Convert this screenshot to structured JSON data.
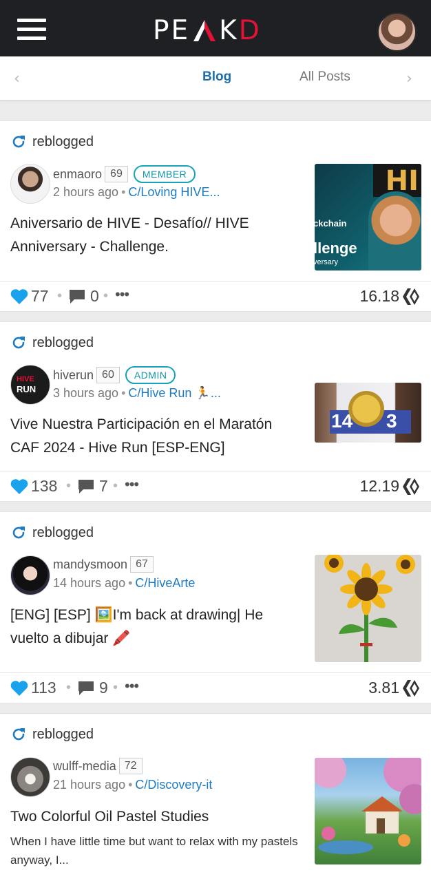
{
  "header": {
    "logo_left": "PE",
    "logo_right": "K",
    "logo_accent": "D"
  },
  "tabs": {
    "active": "Blog",
    "inactive": "All Posts"
  },
  "posts": [
    {
      "reblog_label": "reblogged",
      "author": "enmaoro",
      "reputation": "69",
      "role": "MEMBER",
      "time": "2 hours ago",
      "community": "C/Loving HIVE...",
      "title": "Aniversario de HIVE - Desafío// HIVE Anniversary - Challenge.",
      "upvotes": "77",
      "comments": "0",
      "payout": "16.18",
      "thumb_text_1": "ckchain",
      "thumb_text_2": "llenge",
      "thumb_text_3": "versary",
      "thumb_text_4": "HI"
    },
    {
      "reblog_label": "reblogged",
      "author": "hiverun",
      "reputation": "60",
      "role": "ADMIN",
      "time": "3 hours ago",
      "community": "C/Hive Run 🏃...",
      "title": "Vive Nuestra Participación en el Maratón CAF 2024 - Hive Run [ESP-ENG]",
      "upvotes": "138",
      "comments": "7",
      "payout": "12.19",
      "avatar_text_1": "HIVE",
      "avatar_text_2": "RUN",
      "thumb_text_1": "14",
      "thumb_text_2": "3"
    },
    {
      "reblog_label": "reblogged",
      "author": "mandysmoon",
      "reputation": "67",
      "time": "14 hours ago",
      "community": "C/HiveArte",
      "title": "[ENG] [ESP] 🖼️I'm back at drawing| He vuelto a dibujar 🖍️",
      "upvotes": "113",
      "comments": "9",
      "payout": "3.81"
    },
    {
      "reblog_label": "reblogged",
      "author": "wulff-media",
      "reputation": "72",
      "time": "21 hours ago",
      "community": "C/Discovery-it",
      "title": "Two Colorful Oil Pastel Studies",
      "excerpt": "When I have little time but want to relax with my pastels anyway, I..."
    }
  ],
  "colors": {
    "topbar": "#1f2024",
    "brand_red": "#e31337",
    "link_blue": "#1e7bc0",
    "heart_blue": "#1aa3ec",
    "badge_teal": "#17a2b8"
  }
}
